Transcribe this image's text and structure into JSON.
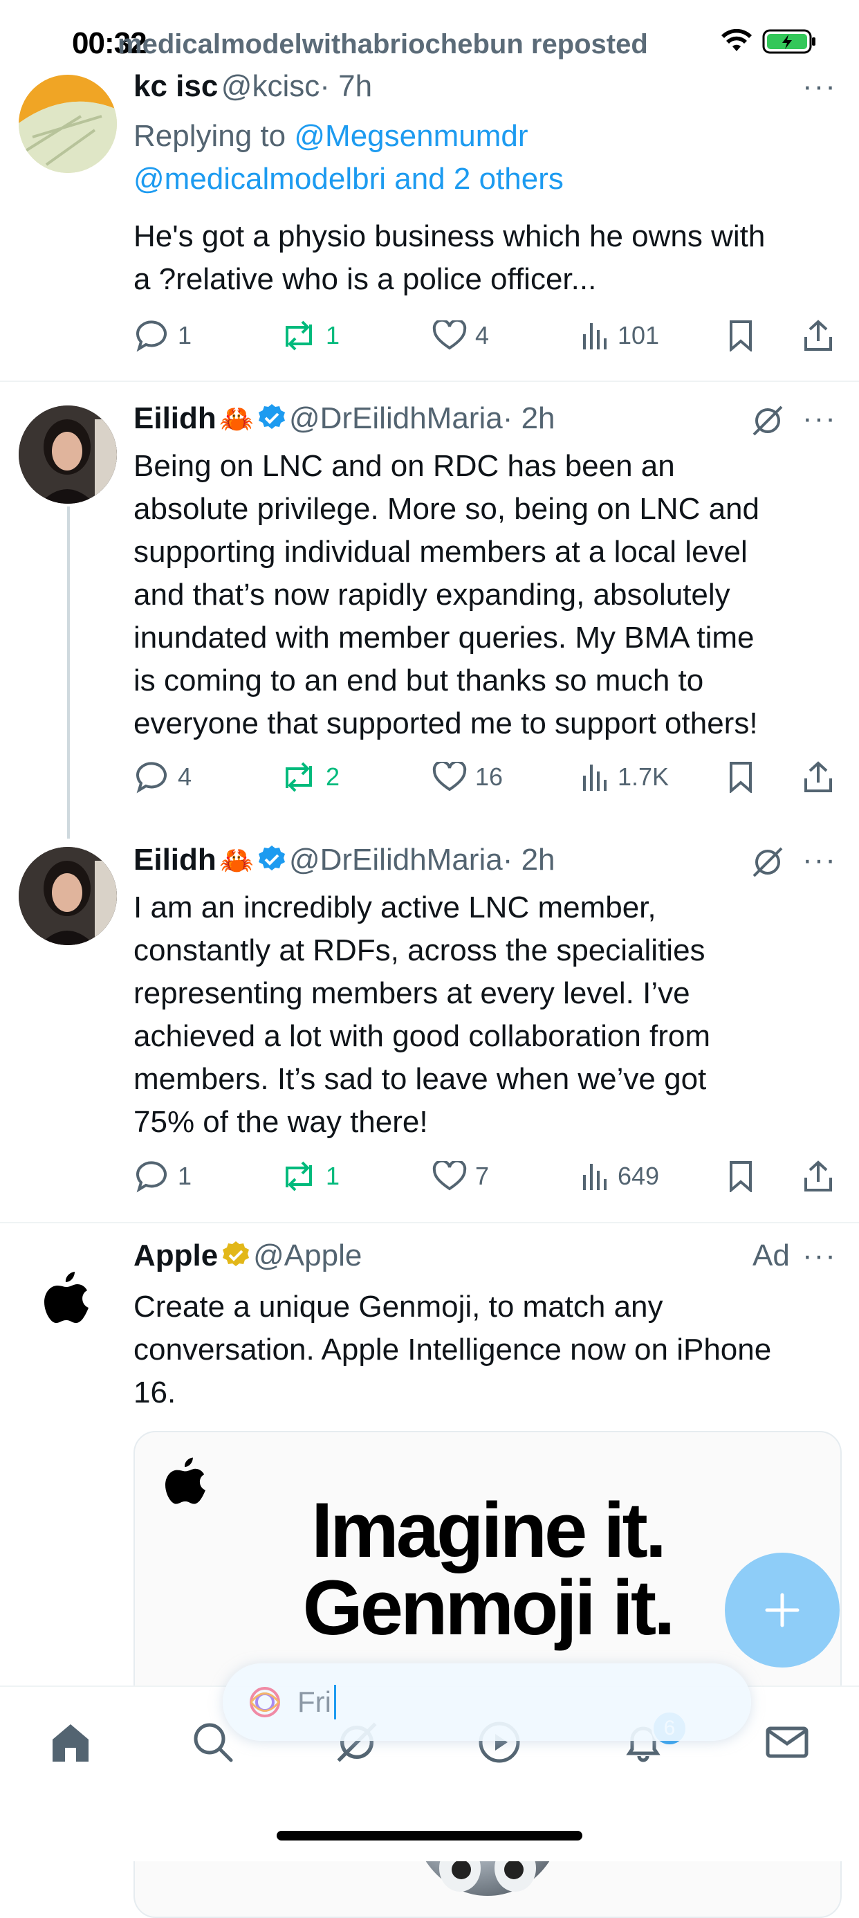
{
  "status_bar": {
    "time": "00:32",
    "repost_banner": "medicalmodelwithabriochebun reposted"
  },
  "tweets": [
    {
      "name": "kc isc",
      "handle": "@kcisc",
      "time": "· 7h",
      "replying_prefix": "Replying to",
      "replying_to_1": "@Megsenmumdr",
      "replying_to_2": "@medicalmodelbri and 2 others",
      "text_lines": [
        "He's got a physio business which he owns with",
        "a ?relative who is a police officer..."
      ],
      "replies": "1",
      "reposts": "1",
      "likes": "4",
      "views": "101"
    },
    {
      "name": "Eilidh",
      "emoji": "🦀",
      "handle": "@DrEilidhMaria",
      "time": "· 2h",
      "text_lines": [
        "Being on LNC and on RDC has been an",
        "absolute privilege. More so, being on LNC and",
        "supporting individual members at a local level",
        "and that’s now rapidly expanding, absolutely",
        "inundated with member queries. My BMA time",
        "is coming to an end but thanks so much to",
        "everyone that supported me to support others!"
      ],
      "replies": "4",
      "reposts": "2",
      "likes": "16",
      "views": "1.7K"
    },
    {
      "name": "Eilidh",
      "emoji": "🦀",
      "handle": "@DrEilidhMaria",
      "time": "· 2h",
      "text_lines": [
        "I am an incredibly active LNC member,",
        "constantly at RDFs, across the specialities",
        "representing members at every level. I’ve",
        "achieved a lot with good collaboration from",
        "members. It’s sad to leave when we’ve got",
        "75% of the way there!"
      ],
      "replies": "1",
      "reposts": "1",
      "likes": "7",
      "views": "649"
    }
  ],
  "ad": {
    "name": "Apple",
    "handle": "@Apple",
    "ad_label": "Ad",
    "text_lines": [
      "Create a unique Genmoji, to match any",
      "conversation. Apple Intelligence now on iPhone",
      "16."
    ],
    "headline_1": "Imagine it.",
    "headline_2": "Genmoji it."
  },
  "grok_input": {
    "value": "Fri"
  },
  "nav": {
    "notifications_badge": "6"
  },
  "colors": {
    "accent": "#1d9bf0",
    "repost_green": "#00ba7c",
    "text": "#0f1419",
    "muted": "#536471",
    "gold_check": "#e2b719"
  }
}
